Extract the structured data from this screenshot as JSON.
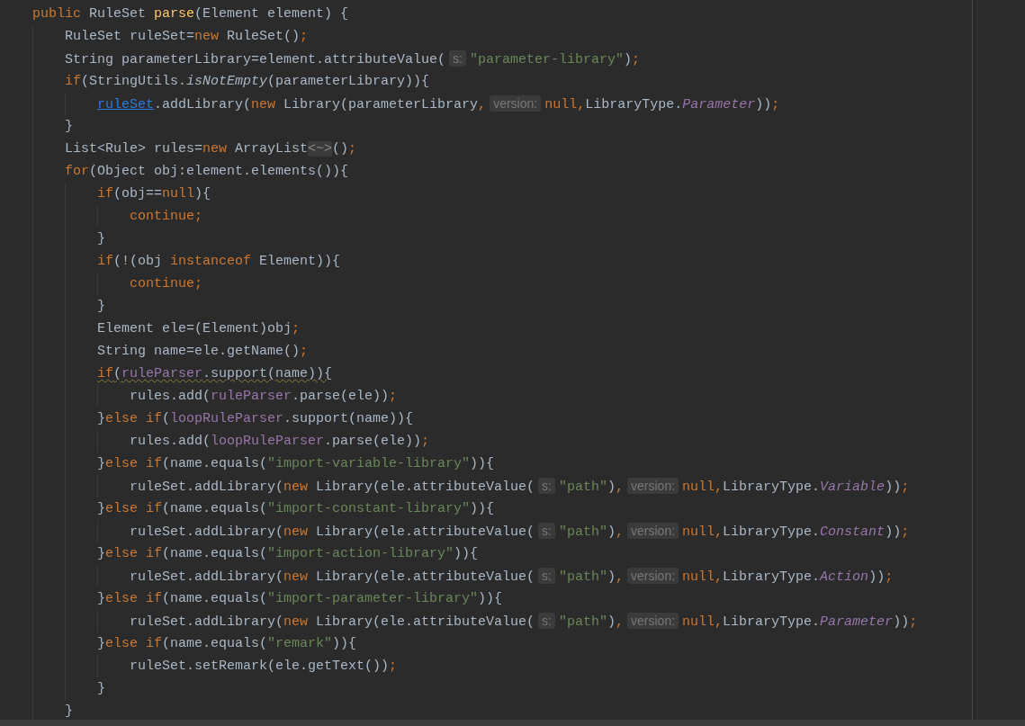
{
  "lines": [
    {
      "warning": false,
      "tokens": [
        {
          "kind": "kw",
          "text": "public"
        },
        {
          "kind": "plain",
          "text": " RuleSet "
        },
        {
          "kind": "decl",
          "text": "parse"
        },
        {
          "kind": "plain",
          "text": "(Element element) {"
        }
      ],
      "children": [
        {
          "warning": false,
          "tokens": [
            {
              "kind": "plain",
              "text": "RuleSet ruleSet="
            },
            {
              "kind": "kw",
              "text": "new"
            },
            {
              "kind": "plain",
              "text": " RuleSet()"
            },
            {
              "kind": "kw",
              "text": ";"
            }
          ]
        },
        {
          "warning": false,
          "tokens": [
            {
              "kind": "plain",
              "text": "String parameterLibrary=element.attributeValue("
            },
            {
              "kind": "hint",
              "text": "s:"
            },
            {
              "kind": "str",
              "text": "\"parameter-library\""
            },
            {
              "kind": "plain",
              "text": ")"
            },
            {
              "kind": "kw",
              "text": ";"
            }
          ]
        },
        {
          "warning": false,
          "tokens": [
            {
              "kind": "kw",
              "text": "if"
            },
            {
              "kind": "plain",
              "text": "(StringUtils."
            },
            {
              "kind": "static",
              "text": "isNotEmpty"
            },
            {
              "kind": "plain",
              "text": "(parameterLibrary)){"
            }
          ],
          "children": [
            {
              "warning": false,
              "tokens": [
                {
                  "kind": "link",
                  "text": "ruleSet"
                },
                {
                  "kind": "plain",
                  "text": ".addLibrary("
                },
                {
                  "kind": "kw",
                  "text": "new"
                },
                {
                  "kind": "plain",
                  "text": " Library(parameterLibrary"
                },
                {
                  "kind": "kw",
                  "text": ","
                },
                {
                  "kind": "hint",
                  "text": "version:"
                },
                {
                  "kind": "kw",
                  "text": "null,"
                },
                {
                  "kind": "plain",
                  "text": "LibraryType."
                },
                {
                  "kind": "enum",
                  "text": "Parameter"
                },
                {
                  "kind": "plain",
                  "text": "))"
                },
                {
                  "kind": "kw",
                  "text": ";"
                }
              ]
            }
          ]
        },
        {
          "warning": false,
          "tokens": [
            {
              "kind": "plain",
              "text": "}"
            }
          ]
        },
        {
          "warning": false,
          "tokens": [
            {
              "kind": "plain",
              "text": "List<Rule> rules="
            },
            {
              "kind": "kw",
              "text": "new"
            },
            {
              "kind": "plain",
              "text": " ArrayList"
            },
            {
              "kind": "fold",
              "text": "<~>"
            },
            {
              "kind": "plain",
              "text": "()"
            },
            {
              "kind": "kw",
              "text": ";"
            }
          ]
        },
        {
          "warning": false,
          "tokens": [
            {
              "kind": "kw",
              "text": "for"
            },
            {
              "kind": "plain",
              "text": "(Object obj:element.elements()){"
            }
          ],
          "children": [
            {
              "warning": false,
              "tokens": [
                {
                  "kind": "kw",
                  "text": "if"
                },
                {
                  "kind": "plain",
                  "text": "(obj=="
                },
                {
                  "kind": "kw",
                  "text": "null"
                },
                {
                  "kind": "plain",
                  "text": "){"
                }
              ],
              "children": [
                {
                  "warning": false,
                  "tokens": [
                    {
                      "kind": "kw",
                      "text": "continue;"
                    }
                  ]
                }
              ]
            },
            {
              "warning": false,
              "tokens": [
                {
                  "kind": "plain",
                  "text": "}"
                }
              ]
            },
            {
              "warning": false,
              "tokens": [
                {
                  "kind": "kw",
                  "text": "if"
                },
                {
                  "kind": "plain",
                  "text": "(!(obj "
                },
                {
                  "kind": "kw",
                  "text": "instanceof"
                },
                {
                  "kind": "plain",
                  "text": " Element)){"
                }
              ],
              "children": [
                {
                  "warning": false,
                  "tokens": [
                    {
                      "kind": "kw",
                      "text": "continue;"
                    }
                  ]
                }
              ]
            },
            {
              "warning": false,
              "tokens": [
                {
                  "kind": "plain",
                  "text": "}"
                }
              ]
            },
            {
              "warning": false,
              "tokens": [
                {
                  "kind": "plain",
                  "text": "Element ele=(Element)obj"
                },
                {
                  "kind": "kw",
                  "text": ";"
                }
              ]
            },
            {
              "warning": false,
              "tokens": [
                {
                  "kind": "plain",
                  "text": "String name=ele.getName()"
                },
                {
                  "kind": "kw",
                  "text": ";"
                }
              ]
            },
            {
              "warning": true,
              "tokens": [
                {
                  "kind": "kw",
                  "text": "if"
                },
                {
                  "kind": "plain",
                  "text": "("
                },
                {
                  "kind": "field",
                  "text": "ruleParser"
                },
                {
                  "kind": "plain",
                  "text": ".support(name)){"
                }
              ],
              "children": [
                {
                  "warning": false,
                  "tokens": [
                    {
                      "kind": "plain",
                      "text": "rules.add("
                    },
                    {
                      "kind": "field",
                      "text": "ruleParser"
                    },
                    {
                      "kind": "plain",
                      "text": ".parse(ele))"
                    },
                    {
                      "kind": "kw",
                      "text": ";"
                    }
                  ]
                }
              ]
            },
            {
              "warning": false,
              "tokens": [
                {
                  "kind": "plain",
                  "text": "}"
                },
                {
                  "kind": "kw",
                  "text": "else if"
                },
                {
                  "kind": "plain",
                  "text": "("
                },
                {
                  "kind": "field",
                  "text": "loopRuleParser"
                },
                {
                  "kind": "plain",
                  "text": ".support(name)){"
                }
              ],
              "children": [
                {
                  "warning": false,
                  "tokens": [
                    {
                      "kind": "plain",
                      "text": "rules.add("
                    },
                    {
                      "kind": "field",
                      "text": "loopRuleParser"
                    },
                    {
                      "kind": "plain",
                      "text": ".parse(ele))"
                    },
                    {
                      "kind": "kw",
                      "text": ";"
                    }
                  ]
                }
              ]
            },
            {
              "warning": false,
              "tokens": [
                {
                  "kind": "plain",
                  "text": "}"
                },
                {
                  "kind": "kw",
                  "text": "else if"
                },
                {
                  "kind": "plain",
                  "text": "(name.equals("
                },
                {
                  "kind": "str",
                  "text": "\"import-variable-library\""
                },
                {
                  "kind": "plain",
                  "text": ")){"
                }
              ],
              "children": [
                {
                  "warning": false,
                  "tokens": [
                    {
                      "kind": "plain",
                      "text": "ruleSet.addLibrary("
                    },
                    {
                      "kind": "kw",
                      "text": "new"
                    },
                    {
                      "kind": "plain",
                      "text": " Library(ele.attributeValue("
                    },
                    {
                      "kind": "hint",
                      "text": "s:"
                    },
                    {
                      "kind": "str",
                      "text": "\"path\""
                    },
                    {
                      "kind": "plain",
                      "text": ")"
                    },
                    {
                      "kind": "kw",
                      "text": ","
                    },
                    {
                      "kind": "hint",
                      "text": "version:"
                    },
                    {
                      "kind": "kw",
                      "text": "null,"
                    },
                    {
                      "kind": "plain",
                      "text": "LibraryType."
                    },
                    {
                      "kind": "enum",
                      "text": "Variable"
                    },
                    {
                      "kind": "plain",
                      "text": "))"
                    },
                    {
                      "kind": "kw",
                      "text": ";"
                    }
                  ]
                }
              ]
            },
            {
              "warning": false,
              "tokens": [
                {
                  "kind": "plain",
                  "text": "}"
                },
                {
                  "kind": "kw",
                  "text": "else if"
                },
                {
                  "kind": "plain",
                  "text": "(name.equals("
                },
                {
                  "kind": "str",
                  "text": "\"import-constant-library\""
                },
                {
                  "kind": "plain",
                  "text": ")){"
                }
              ],
              "children": [
                {
                  "warning": false,
                  "tokens": [
                    {
                      "kind": "plain",
                      "text": "ruleSet.addLibrary("
                    },
                    {
                      "kind": "kw",
                      "text": "new"
                    },
                    {
                      "kind": "plain",
                      "text": " Library(ele.attributeValue("
                    },
                    {
                      "kind": "hint",
                      "text": "s:"
                    },
                    {
                      "kind": "str",
                      "text": "\"path\""
                    },
                    {
                      "kind": "plain",
                      "text": ")"
                    },
                    {
                      "kind": "kw",
                      "text": ","
                    },
                    {
                      "kind": "hint",
                      "text": "version:"
                    },
                    {
                      "kind": "kw",
                      "text": "null,"
                    },
                    {
                      "kind": "plain",
                      "text": "LibraryType."
                    },
                    {
                      "kind": "enum",
                      "text": "Constant"
                    },
                    {
                      "kind": "plain",
                      "text": "))"
                    },
                    {
                      "kind": "kw",
                      "text": ";"
                    }
                  ]
                }
              ]
            },
            {
              "warning": false,
              "tokens": [
                {
                  "kind": "plain",
                  "text": "}"
                },
                {
                  "kind": "kw",
                  "text": "else if"
                },
                {
                  "kind": "plain",
                  "text": "(name.equals("
                },
                {
                  "kind": "str",
                  "text": "\"import-action-library\""
                },
                {
                  "kind": "plain",
                  "text": ")){"
                }
              ],
              "children": [
                {
                  "warning": false,
                  "tokens": [
                    {
                      "kind": "plain",
                      "text": "ruleSet.addLibrary("
                    },
                    {
                      "kind": "kw",
                      "text": "new"
                    },
                    {
                      "kind": "plain",
                      "text": " Library(ele.attributeValue("
                    },
                    {
                      "kind": "hint",
                      "text": "s:"
                    },
                    {
                      "kind": "str",
                      "text": "\"path\""
                    },
                    {
                      "kind": "plain",
                      "text": ")"
                    },
                    {
                      "kind": "kw",
                      "text": ","
                    },
                    {
                      "kind": "hint",
                      "text": "version:"
                    },
                    {
                      "kind": "kw",
                      "text": "null,"
                    },
                    {
                      "kind": "plain",
                      "text": "LibraryType."
                    },
                    {
                      "kind": "enum",
                      "text": "Action"
                    },
                    {
                      "kind": "plain",
                      "text": "))"
                    },
                    {
                      "kind": "kw",
                      "text": ";"
                    }
                  ]
                }
              ]
            },
            {
              "warning": false,
              "tokens": [
                {
                  "kind": "plain",
                  "text": "}"
                },
                {
                  "kind": "kw",
                  "text": "else if"
                },
                {
                  "kind": "plain",
                  "text": "(name.equals("
                },
                {
                  "kind": "str",
                  "text": "\"import-parameter-library\""
                },
                {
                  "kind": "plain",
                  "text": ")){"
                }
              ],
              "children": [
                {
                  "warning": false,
                  "tokens": [
                    {
                      "kind": "plain",
                      "text": "ruleSet.addLibrary("
                    },
                    {
                      "kind": "kw",
                      "text": "new"
                    },
                    {
                      "kind": "plain",
                      "text": " Library(ele.attributeValue("
                    },
                    {
                      "kind": "hint",
                      "text": "s:"
                    },
                    {
                      "kind": "str",
                      "text": "\"path\""
                    },
                    {
                      "kind": "plain",
                      "text": ")"
                    },
                    {
                      "kind": "kw",
                      "text": ","
                    },
                    {
                      "kind": "hint",
                      "text": "version:"
                    },
                    {
                      "kind": "kw",
                      "text": "null,"
                    },
                    {
                      "kind": "plain",
                      "text": "LibraryType."
                    },
                    {
                      "kind": "enum",
                      "text": "Parameter"
                    },
                    {
                      "kind": "plain",
                      "text": "))"
                    },
                    {
                      "kind": "kw",
                      "text": ";"
                    }
                  ]
                }
              ]
            },
            {
              "warning": false,
              "tokens": [
                {
                  "kind": "plain",
                  "text": "}"
                },
                {
                  "kind": "kw",
                  "text": "else if"
                },
                {
                  "kind": "plain",
                  "text": "(name.equals("
                },
                {
                  "kind": "str",
                  "text": "\"remark\""
                },
                {
                  "kind": "plain",
                  "text": ")){"
                }
              ],
              "children": [
                {
                  "warning": false,
                  "tokens": [
                    {
                      "kind": "plain",
                      "text": "ruleSet.setRemark(ele.getText())"
                    },
                    {
                      "kind": "kw",
                      "text": ";"
                    }
                  ]
                }
              ]
            },
            {
              "warning": false,
              "tokens": [
                {
                  "kind": "plain",
                  "text": "}"
                }
              ]
            }
          ]
        },
        {
          "warning": false,
          "tokens": [
            {
              "kind": "plain",
              "text": "}"
            }
          ]
        }
      ]
    }
  ]
}
